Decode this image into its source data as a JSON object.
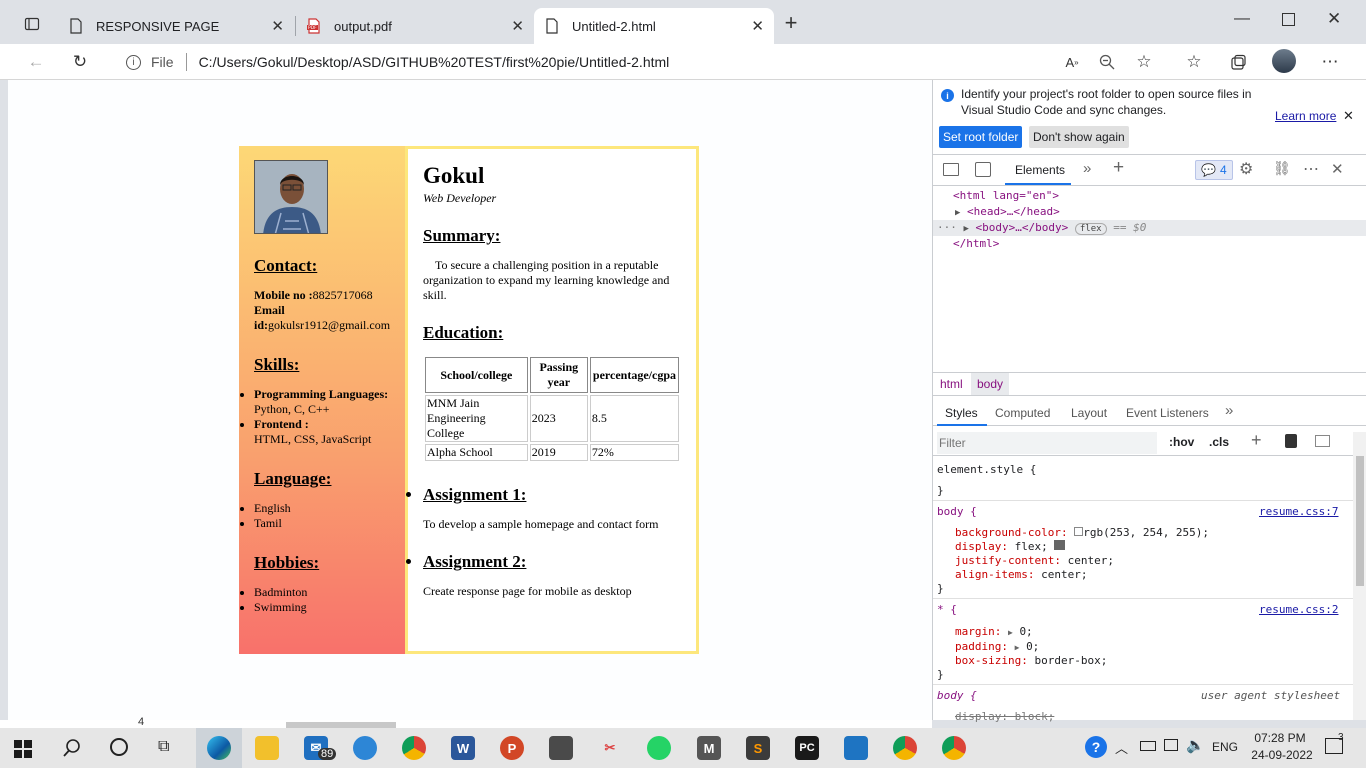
{
  "browser": {
    "tabs": [
      {
        "title": "RESPONSIVE PAGE",
        "icon": "page-icon"
      },
      {
        "title": "output.pdf",
        "icon": "pdf-icon"
      },
      {
        "title": "Untitled-2.html",
        "icon": "page-icon"
      }
    ],
    "address": {
      "scheme_label": "File",
      "url": "C:/Users/Gokul/Desktop/ASD/GITHUB%20TEST/first%20pie/Untitled-2.html"
    }
  },
  "resume": {
    "name": "Gokul",
    "role": "Web Developer",
    "contact": {
      "heading": "Contact:",
      "mobile_label": "Mobile no :",
      "mobile": "8825717068",
      "email_label": "Email id:",
      "email": "gokulsr1912@gmail.com"
    },
    "skills": {
      "heading": "Skills:",
      "items": [
        {
          "label": "Programming Languages:",
          "value": "Python, C, C++"
        },
        {
          "label": "Frontend :",
          "value": "HTML, CSS, JavaScript"
        }
      ]
    },
    "language": {
      "heading": "Language:",
      "items": [
        "English",
        "Tamil"
      ]
    },
    "hobbies": {
      "heading": "Hobbies:",
      "items": [
        "Badminton",
        "Swimming"
      ]
    },
    "summary": {
      "heading": "Summary:",
      "text": "To secure a challenging position in a reputable organization to expand my learning knowledge and skill."
    },
    "education": {
      "heading": "Education:",
      "columns": [
        "School/college",
        "Passing year",
        "percentage/cgpa"
      ],
      "rows": [
        [
          "MNM Jain Engineering College",
          "2023",
          "8.5"
        ],
        [
          "Alpha School",
          "2019",
          "72%"
        ]
      ]
    },
    "assignments": [
      {
        "heading": "Assignment 1:",
        "text": "To develop a sample homepage and contact form"
      },
      {
        "heading": "Assignment 2:",
        "text": "Create response page for mobile as desktop"
      }
    ]
  },
  "devtools": {
    "infobar": {
      "message": "Identify your project's root folder to open source files in Visual Studio Code and sync changes.",
      "learn_more": "Learn more",
      "set_root": "Set root folder",
      "dont_show": "Don't show again"
    },
    "tabs": {
      "elements": "Elements",
      "issues_count": "4"
    },
    "dom": {
      "html_open": "<html lang=\"en\">",
      "head": "<head>…</head>",
      "body": "<body>…</body>",
      "flex_badge": "flex",
      "eq": "== $0",
      "html_close": "</html>"
    },
    "breadcrumbs": [
      "html",
      "body"
    ],
    "styles_tabs": [
      "Styles",
      "Computed",
      "Layout",
      "Event Listeners"
    ],
    "filter_placeholder": "Filter",
    "hov": ":hov",
    "cls": ".cls",
    "rules": {
      "element_style": "element.style {",
      "close": "}",
      "body_sel": "body {",
      "body_src": "resume.css:7",
      "body_props": [
        [
          "background-color:",
          "rgb(253, 254, 255);"
        ],
        [
          "display:",
          "flex;"
        ],
        [
          "justify-content:",
          "center;"
        ],
        [
          "align-items:",
          "center;"
        ]
      ],
      "star_sel": "* {",
      "star_src": "resume.css:2",
      "star_props": [
        [
          "margin:",
          "0;"
        ],
        [
          "padding:",
          "0;"
        ],
        [
          "box-sizing:",
          "border-box;"
        ]
      ],
      "ua_sel": "body {",
      "ua_src": "user agent stylesheet",
      "ua_prop": "display: block;"
    }
  },
  "taskbar": {
    "mail_badge": "89",
    "lang": "ENG",
    "time": "07:28 PM",
    "date": "24-09-2022",
    "notif_count": "3",
    "small_count": "4"
  },
  "colors": {
    "accent": "#0067c0",
    "sidebar_top": "#fdd876",
    "sidebar_bottom": "#f8716b",
    "main_border": "#fde77c"
  }
}
